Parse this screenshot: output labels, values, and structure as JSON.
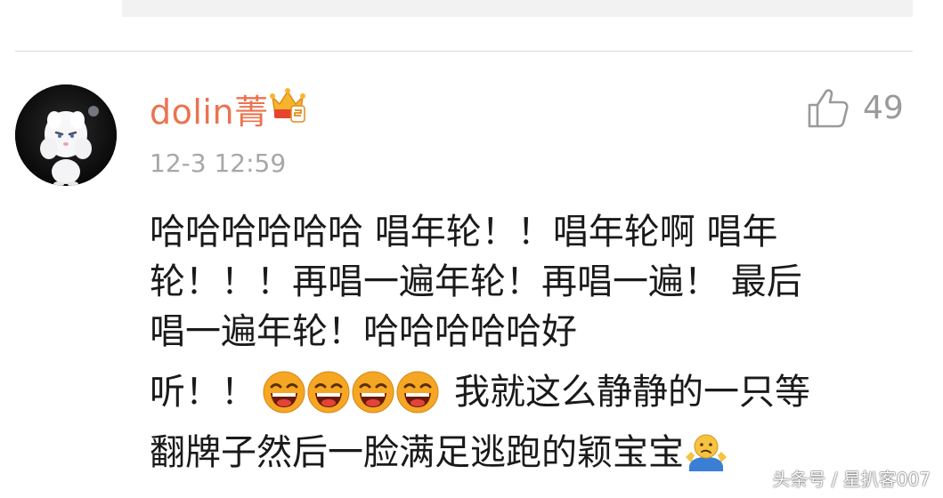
{
  "comment": {
    "username": "dolin菁",
    "timestamp": "12-3 12:59",
    "like_count": "49",
    "text": {
      "line1": "哈哈哈哈哈哈 唱年轮！！唱年轮啊 唱年",
      "line2": "轮！！！再唱一遍年轮！再唱一遍！ 最后",
      "line3": "唱一遍年轮！哈哈哈哈哈好",
      "line4_start": "听！！",
      "line4_end": "我就这么静静的一只等",
      "line5": "翻牌子然后一脸满足逃跑的颖宝宝"
    },
    "emojis": [
      "laughing-emoji",
      "laughing-emoji",
      "laughing-emoji",
      "laughing-emoji",
      "shrug-emoji"
    ]
  },
  "icons": {
    "badge": "crown-vip-icon",
    "like": "thumbs-up-icon"
  },
  "colors": {
    "username": "#eb7350",
    "timestamp": "#a7a7a7",
    "like": "#9a9a9a",
    "divider": "#dcdcdc"
  },
  "watermark": "头条号 / 星扒客007"
}
